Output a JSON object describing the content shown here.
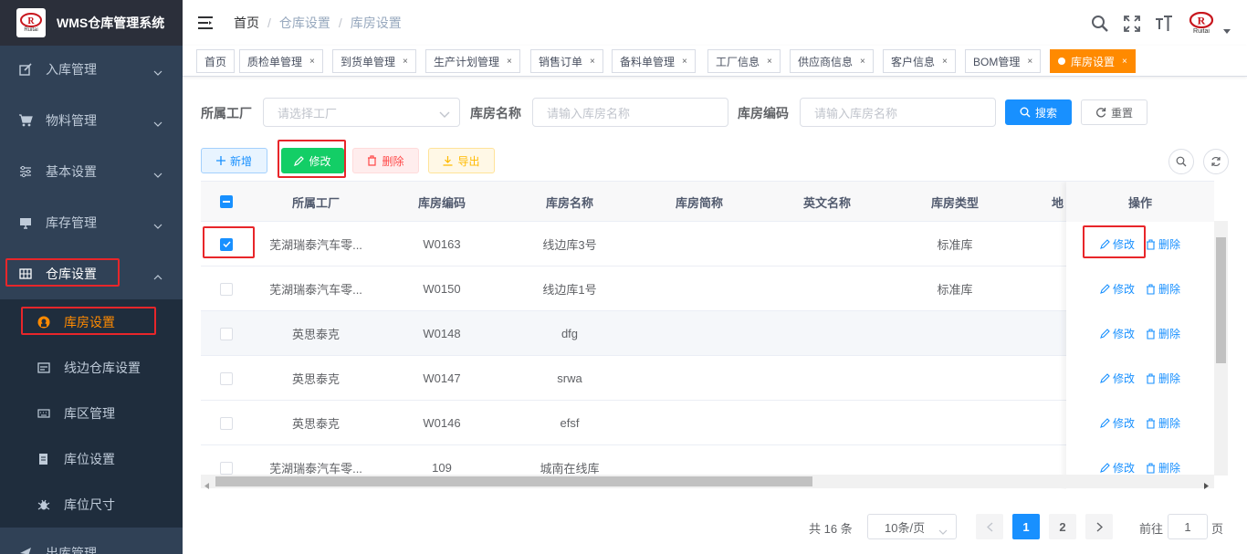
{
  "app": {
    "title": "WMS仓库管理系统",
    "logo_text": "Ruitai"
  },
  "sidebar": {
    "menus": [
      {
        "label": "入库管理",
        "icon": "edit-icon"
      },
      {
        "label": "物料管理",
        "icon": "cart-icon"
      },
      {
        "label": "基本设置",
        "icon": "sliders-icon"
      },
      {
        "label": "库存管理",
        "icon": "monitor-icon"
      },
      {
        "label": "仓库设置",
        "icon": "grid-icon"
      },
      {
        "label": "出库管理",
        "icon": "send-icon"
      }
    ],
    "submenu": [
      {
        "label": "库房设置",
        "icon": "github-icon"
      },
      {
        "label": "线边仓库设置",
        "icon": "card-icon"
      },
      {
        "label": "库区管理",
        "icon": "keyboard-icon"
      },
      {
        "label": "库位设置",
        "icon": "doc-icon"
      },
      {
        "label": "库位尺寸",
        "icon": "bug-icon"
      }
    ]
  },
  "breadcrumb": [
    "首页",
    "仓库设置",
    "库房设置"
  ],
  "tags": [
    "首页",
    "质检单管理",
    "到货单管理",
    "生产计划管理",
    "销售订单",
    "备料单管理",
    "工厂信息",
    "供应商信息",
    "客户信息",
    "BOM管理",
    "库房设置"
  ],
  "search": {
    "factory_label": "所属工厂",
    "factory_placeholder": "请选择工厂",
    "name_label": "库房名称",
    "name_placeholder": "请输入库房名称",
    "code_label": "库房编码",
    "code_placeholder": "请输入库房名称",
    "search_btn": "搜索",
    "reset_btn": "重置"
  },
  "toolbar": {
    "add": "新增",
    "edit": "修改",
    "delete": "删除",
    "export": "导出"
  },
  "table": {
    "columns": [
      "所属工厂",
      "库房编码",
      "库房名称",
      "库房简称",
      "英文名称",
      "库房类型",
      "地",
      "操作"
    ],
    "rows": [
      {
        "factory": "芜湖瑞泰汽车零...",
        "code": "W0163",
        "name": "线边库3号",
        "short": "",
        "en": "",
        "type": "标准库",
        "checked": true
      },
      {
        "factory": "芜湖瑞泰汽车零...",
        "code": "W0150",
        "name": "线边库1号",
        "short": "",
        "en": "",
        "type": "标准库",
        "checked": false
      },
      {
        "factory": "英思泰克",
        "code": "W0148",
        "name": "dfg",
        "short": "",
        "en": "",
        "type": "",
        "checked": false
      },
      {
        "factory": "英思泰克",
        "code": "W0147",
        "name": "srwa",
        "short": "",
        "en": "",
        "type": "",
        "checked": false
      },
      {
        "factory": "英思泰克",
        "code": "W0146",
        "name": "efsf",
        "short": "",
        "en": "",
        "type": "",
        "checked": false
      },
      {
        "factory": "芜湖瑞泰汽车零...",
        "code": "109",
        "name": "城南在线库",
        "short": "",
        "en": "",
        "type": "",
        "checked": false
      }
    ],
    "row_edit": "修改",
    "row_delete": "删除"
  },
  "pagination": {
    "total": "共 16 条",
    "page_size": "10条/页",
    "pages": [
      "1",
      "2"
    ],
    "current": "1",
    "goto_prefix": "前往",
    "goto_value": "1",
    "goto_suffix": "页"
  },
  "colors": {
    "sidebar": "#304156",
    "accent": "#ff8a00",
    "primary": "#1890ff",
    "success": "#13ce66",
    "danger": "#ff4949",
    "highlight": "#e8262a"
  }
}
